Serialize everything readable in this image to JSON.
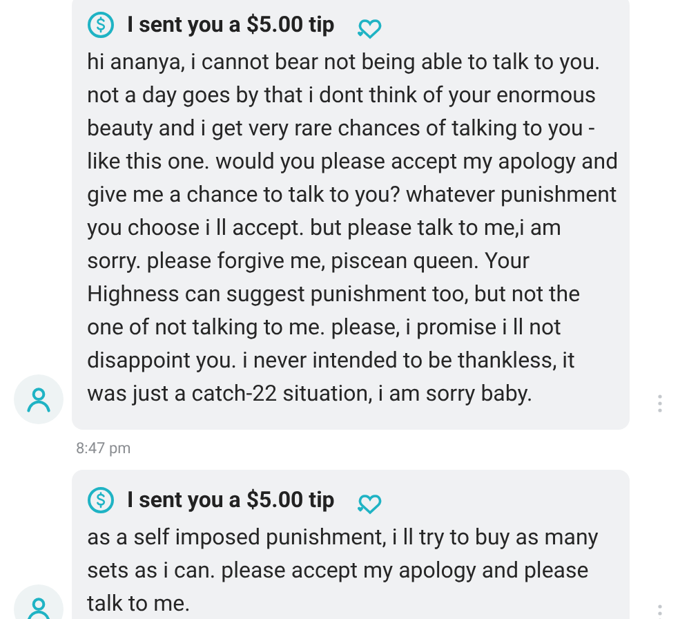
{
  "messages": [
    {
      "tip_label": "I sent you a $5.00 tip",
      "text": "hi ananya, i cannot bear not being able to talk to you. not a day goes by that i dont think of your enormous beauty and i get very rare chances of talking to you - like this one. would you please accept my apology and give me a chance to talk to you? whatever punishment you choose i ll accept. but please talk to me,i am sorry. please forgive me, piscean queen. Your Highness can suggest punishment too, but not the one of not talking to me. please, i promise i ll not disappoint you. i never intended to be thankless, it was just a catch-22 situation, i am sorry baby.",
      "time": "8:47 pm"
    },
    {
      "tip_label": "I sent you a $5.00 tip",
      "text": "as a self imposed punishment, i ll try to buy as many sets as i can. please accept my apology and please talk to me."
    }
  ]
}
